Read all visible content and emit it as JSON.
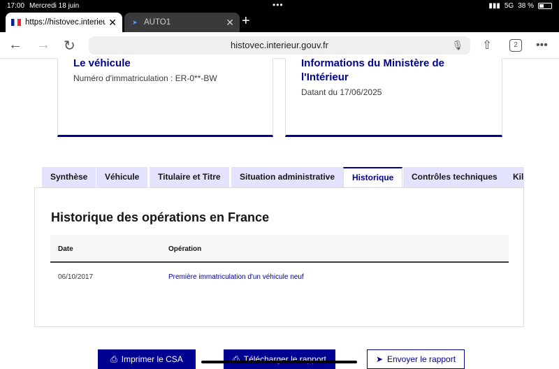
{
  "status_bar": {
    "time": "17:00",
    "date": "Mercredi 18 juin",
    "network": "5G",
    "battery_percent": "38 %",
    "battery_level": 0.38
  },
  "browser": {
    "tabs": [
      {
        "favicon": "french-flag-icon",
        "title": "https://histovec.interieur.gouv.fr",
        "active": true
      },
      {
        "favicon": "auto1-icon",
        "title": "AUTO1",
        "active": false
      }
    ],
    "url": "histovec.interieur.gouv.fr",
    "tab_count": "2"
  },
  "cards": {
    "vehicle": {
      "title": "Le véhicule",
      "subtitle": "Numéro d'immatriculation : ER-0**-BW"
    },
    "ministry": {
      "title": "Informations du Ministère de l'Intérieur",
      "subtitle": "Datant du 17/06/2025"
    }
  },
  "section_tabs": [
    {
      "label": "Synthèse"
    },
    {
      "label": "Véhicule"
    },
    {
      "label": "Titulaire et Titre"
    },
    {
      "label": "Situation administrative"
    },
    {
      "label": "Historique"
    },
    {
      "label": "Contrôles techniques"
    },
    {
      "label": "Kilométrage"
    }
  ],
  "history": {
    "title": "Historique des opérations en France",
    "columns": [
      "Date",
      "Opération"
    ],
    "rows": [
      {
        "date": "06/10/2017",
        "operation": "Première immatriculation d'un véhicule neuf"
      }
    ]
  },
  "actions": {
    "print": "Imprimer le CSA",
    "download": "Télécharger le rapport",
    "send": "Envoyer le rapport"
  },
  "colors": {
    "accent": "#000091",
    "tab_bg": "#e3e3fd"
  }
}
